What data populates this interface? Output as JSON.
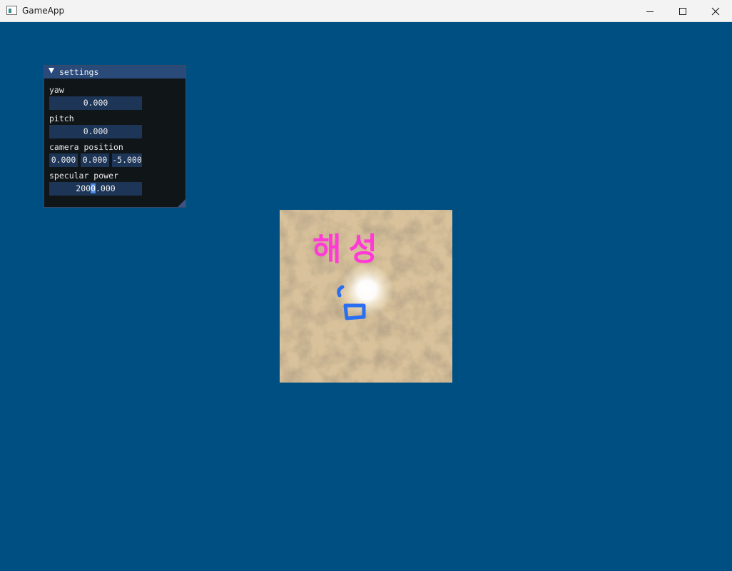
{
  "window": {
    "title": "GameApp",
    "icon": "app-window-icon",
    "controls": [
      "minimize-icon",
      "maximize-icon",
      "close-icon"
    ]
  },
  "colors": {
    "background": "#004f82",
    "panel_bg": "#101518",
    "panel_header": "#2a4a7a",
    "field_bg": "#1d3557",
    "selection": "#4a8ae0",
    "annotation_pink": "#ff3ad6",
    "annotation_blue": "#2a6ff0"
  },
  "settings": {
    "title": "settings",
    "collapse_icon": "triangle-down-icon",
    "yaw": {
      "label": "yaw",
      "value": "0.000"
    },
    "pitch": {
      "label": "pitch",
      "value": "0.000"
    },
    "camera_position": {
      "label": "camera position",
      "x": "0.000",
      "y": "0.000",
      "z": "-5.000"
    },
    "specular_power": {
      "label": "specular power",
      "value_before_sel": "200",
      "value_selected": "0",
      "value_after_sel": ".000"
    }
  },
  "viewport": {
    "annotation_text": "해성"
  }
}
